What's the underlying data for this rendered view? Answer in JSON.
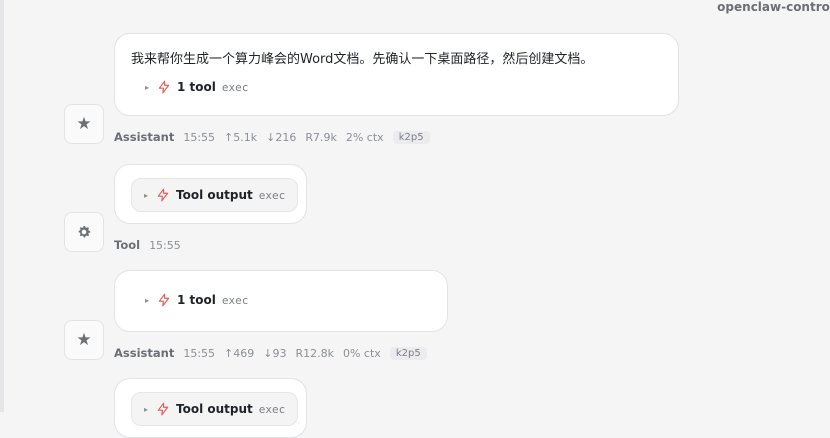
{
  "header": {
    "app_label": "openclaw-control"
  },
  "messages": [
    {
      "role": "assistant",
      "text": "我来帮你生成一个算力峰会的Word文档。先确认一下桌面路径，然后创建文档。",
      "tool_summary": {
        "label": "1 tool",
        "command": "exec"
      },
      "meta": {
        "author": "Assistant",
        "time": "15:55",
        "up": "↑5.1k",
        "down": "↓216",
        "read": "R7.9k",
        "ctx": "2% ctx",
        "model": "k2p5"
      }
    },
    {
      "role": "tool",
      "tool_output": {
        "label": "Tool output",
        "command": "exec"
      },
      "meta": {
        "author": "Tool",
        "time": "15:55"
      }
    },
    {
      "role": "assistant",
      "tool_summary": {
        "label": "1 tool",
        "command": "exec"
      },
      "meta": {
        "author": "Assistant",
        "time": "15:55",
        "up": "↑469",
        "down": "↓93",
        "read": "R12.8k",
        "ctx": "0% ctx",
        "model": "k2p5"
      }
    },
    {
      "role": "tool",
      "tool_output": {
        "label": "Tool output",
        "command": "exec"
      }
    }
  ],
  "icons": {
    "assistant_avatar": "star-icon",
    "tool_avatar": "gear-icon",
    "tool": "bolt-icon",
    "expand": "caret-right-icon"
  },
  "colors": {
    "bolt": "#e0605a",
    "background": "#f5f5f6",
    "bubble": "#ffffff"
  }
}
